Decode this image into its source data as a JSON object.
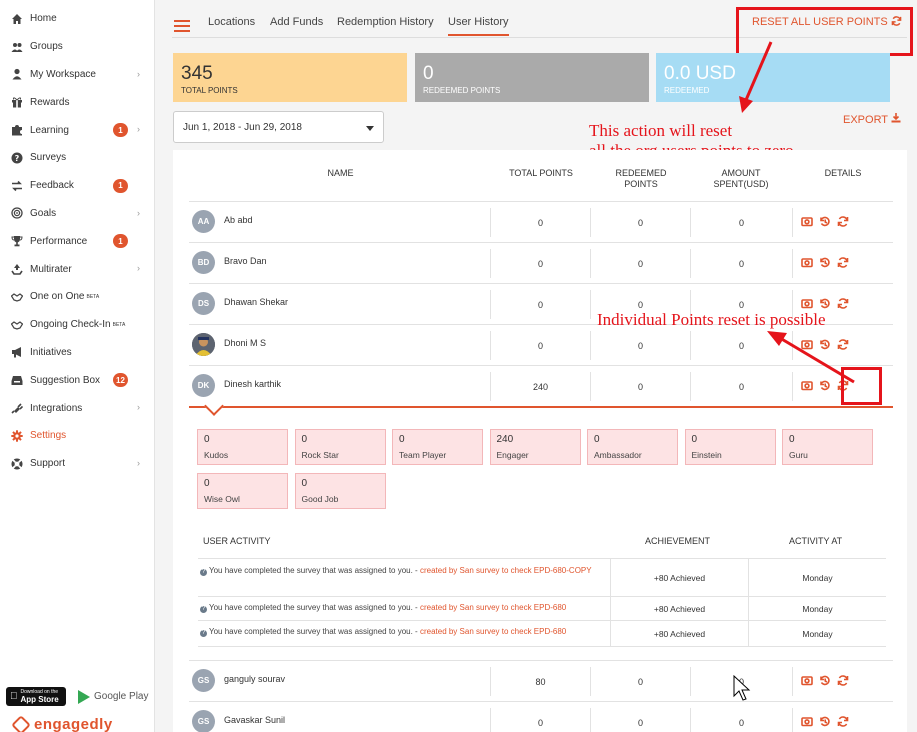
{
  "sidebar": {
    "items": [
      {
        "label": "Home",
        "icon": "home-icon"
      },
      {
        "label": "Groups",
        "icon": "groups-icon"
      },
      {
        "label": "My Workspace",
        "icon": "user-icon",
        "chevron": true
      },
      {
        "label": "Rewards",
        "icon": "gift-icon"
      },
      {
        "label": "Learning",
        "icon": "puzzle-icon",
        "badge": "1",
        "chevron": true
      },
      {
        "label": "Surveys",
        "icon": "question-icon"
      },
      {
        "label": "Feedback",
        "icon": "exchange-icon",
        "badge": "1"
      },
      {
        "label": "Goals",
        "icon": "target-icon",
        "chevron": true
      },
      {
        "label": "Performance",
        "icon": "trophy-icon",
        "badge": "1"
      },
      {
        "label": "Multirater",
        "icon": "recycle-icon",
        "chevron": true
      },
      {
        "label": "One on One",
        "sup": "BETA",
        "icon": "handshake-icon"
      },
      {
        "label": "Ongoing Check-In",
        "sup": "BETA",
        "icon": "handshake-icon"
      },
      {
        "label": "Initiatives",
        "icon": "bullhorn-icon"
      },
      {
        "label": "Suggestion Box",
        "icon": "inbox-icon",
        "badge": "12"
      },
      {
        "label": "Integrations",
        "icon": "plug-icon",
        "chevron": true
      },
      {
        "label": "Settings",
        "icon": "gear-icon",
        "active": true
      },
      {
        "label": "Support",
        "icon": "lifebuoy-icon",
        "chevron": true
      }
    ],
    "appstore_small": "Download on the",
    "appstore_big": "App Store",
    "googleplay": "Google Play",
    "logo": "engagedly"
  },
  "tabs": [
    {
      "label": "Locations"
    },
    {
      "label": "Add Funds"
    },
    {
      "label": "Redemption History"
    },
    {
      "label": "User History",
      "active": true
    }
  ],
  "reset_all_label": "RESET ALL USER POINTS",
  "stats": [
    {
      "value": "345",
      "label": "TOTAL POINTS",
      "color": "#fdd592"
    },
    {
      "value": "0",
      "label": "REDEEMED POINTS",
      "color": "#aaaaaa"
    },
    {
      "value": "0.0 USD",
      "label": "REDEEMED",
      "color": "#a6dcf4"
    }
  ],
  "date_range": "Jun 1, 2018 - Jun 29, 2018",
  "export_label": "EXPORT",
  "annotations": {
    "reset_note_line1": "This action will reset",
    "reset_note_line2": "all the org users points to zero.",
    "individual_note": "Individual Points reset is possible"
  },
  "table": {
    "headers": {
      "name": "NAME",
      "total": "TOTAL POINTS",
      "redeemed_1": "REDEEMED",
      "redeemed_2": "POINTS",
      "amount_1": "AMOUNT",
      "amount_2": "SPENT(USD)",
      "details": "DETAILS"
    },
    "rows": [
      {
        "initials": "AA",
        "name": "Ab abd",
        "total": "0",
        "redeemed": "0",
        "amount": "0"
      },
      {
        "initials": "BD",
        "name": "Bravo Dan",
        "total": "0",
        "redeemed": "0",
        "amount": "0"
      },
      {
        "initials": "DS",
        "name": "Dhawan Shekar",
        "total": "0",
        "redeemed": "0",
        "amount": "0"
      },
      {
        "initials": "",
        "name": "Dhoni M S",
        "total": "0",
        "redeemed": "0",
        "amount": "0"
      },
      {
        "initials": "DK",
        "name": "Dinesh karthik",
        "total": "240",
        "redeemed": "0",
        "amount": "0"
      },
      {
        "initials": "GS",
        "name": "ganguly sourav",
        "total": "80",
        "redeemed": "0",
        "amount": "0"
      },
      {
        "initials": "GS",
        "name": "Gavaskar Sunil",
        "total": "0",
        "redeemed": "0",
        "amount": "0"
      }
    ]
  },
  "badges": [
    {
      "value": "0",
      "label": "Kudos"
    },
    {
      "value": "0",
      "label": "Rock Star"
    },
    {
      "value": "0",
      "label": "Team Player"
    },
    {
      "value": "240",
      "label": "Engager"
    },
    {
      "value": "0",
      "label": "Ambassador"
    },
    {
      "value": "0",
      "label": "Einstein"
    },
    {
      "value": "0",
      "label": "Guru"
    },
    {
      "value": "0",
      "label": "Wise Owl"
    },
    {
      "value": "0",
      "label": "Good Job"
    }
  ],
  "activity": {
    "headers": {
      "activity": "USER ACTIVITY",
      "achievement": "ACHIEVEMENT",
      "at": "ACTIVITY AT"
    },
    "rows": [
      {
        "text": "You have completed the survey that was assigned to you. - ",
        "link": "created by San survey to check EPD-680-COPY",
        "achievement": "+80 Achieved",
        "at": "Monday"
      },
      {
        "text": "You have completed the survey that was assigned to you. - ",
        "link": "created by San survey to check EPD-680",
        "achievement": "+80 Achieved",
        "at": "Monday"
      },
      {
        "text": "You have completed the survey that was assigned to you. - ",
        "link": "created by San survey to check EPD-680",
        "achievement": "+80 Achieved",
        "at": "Monday"
      }
    ]
  }
}
